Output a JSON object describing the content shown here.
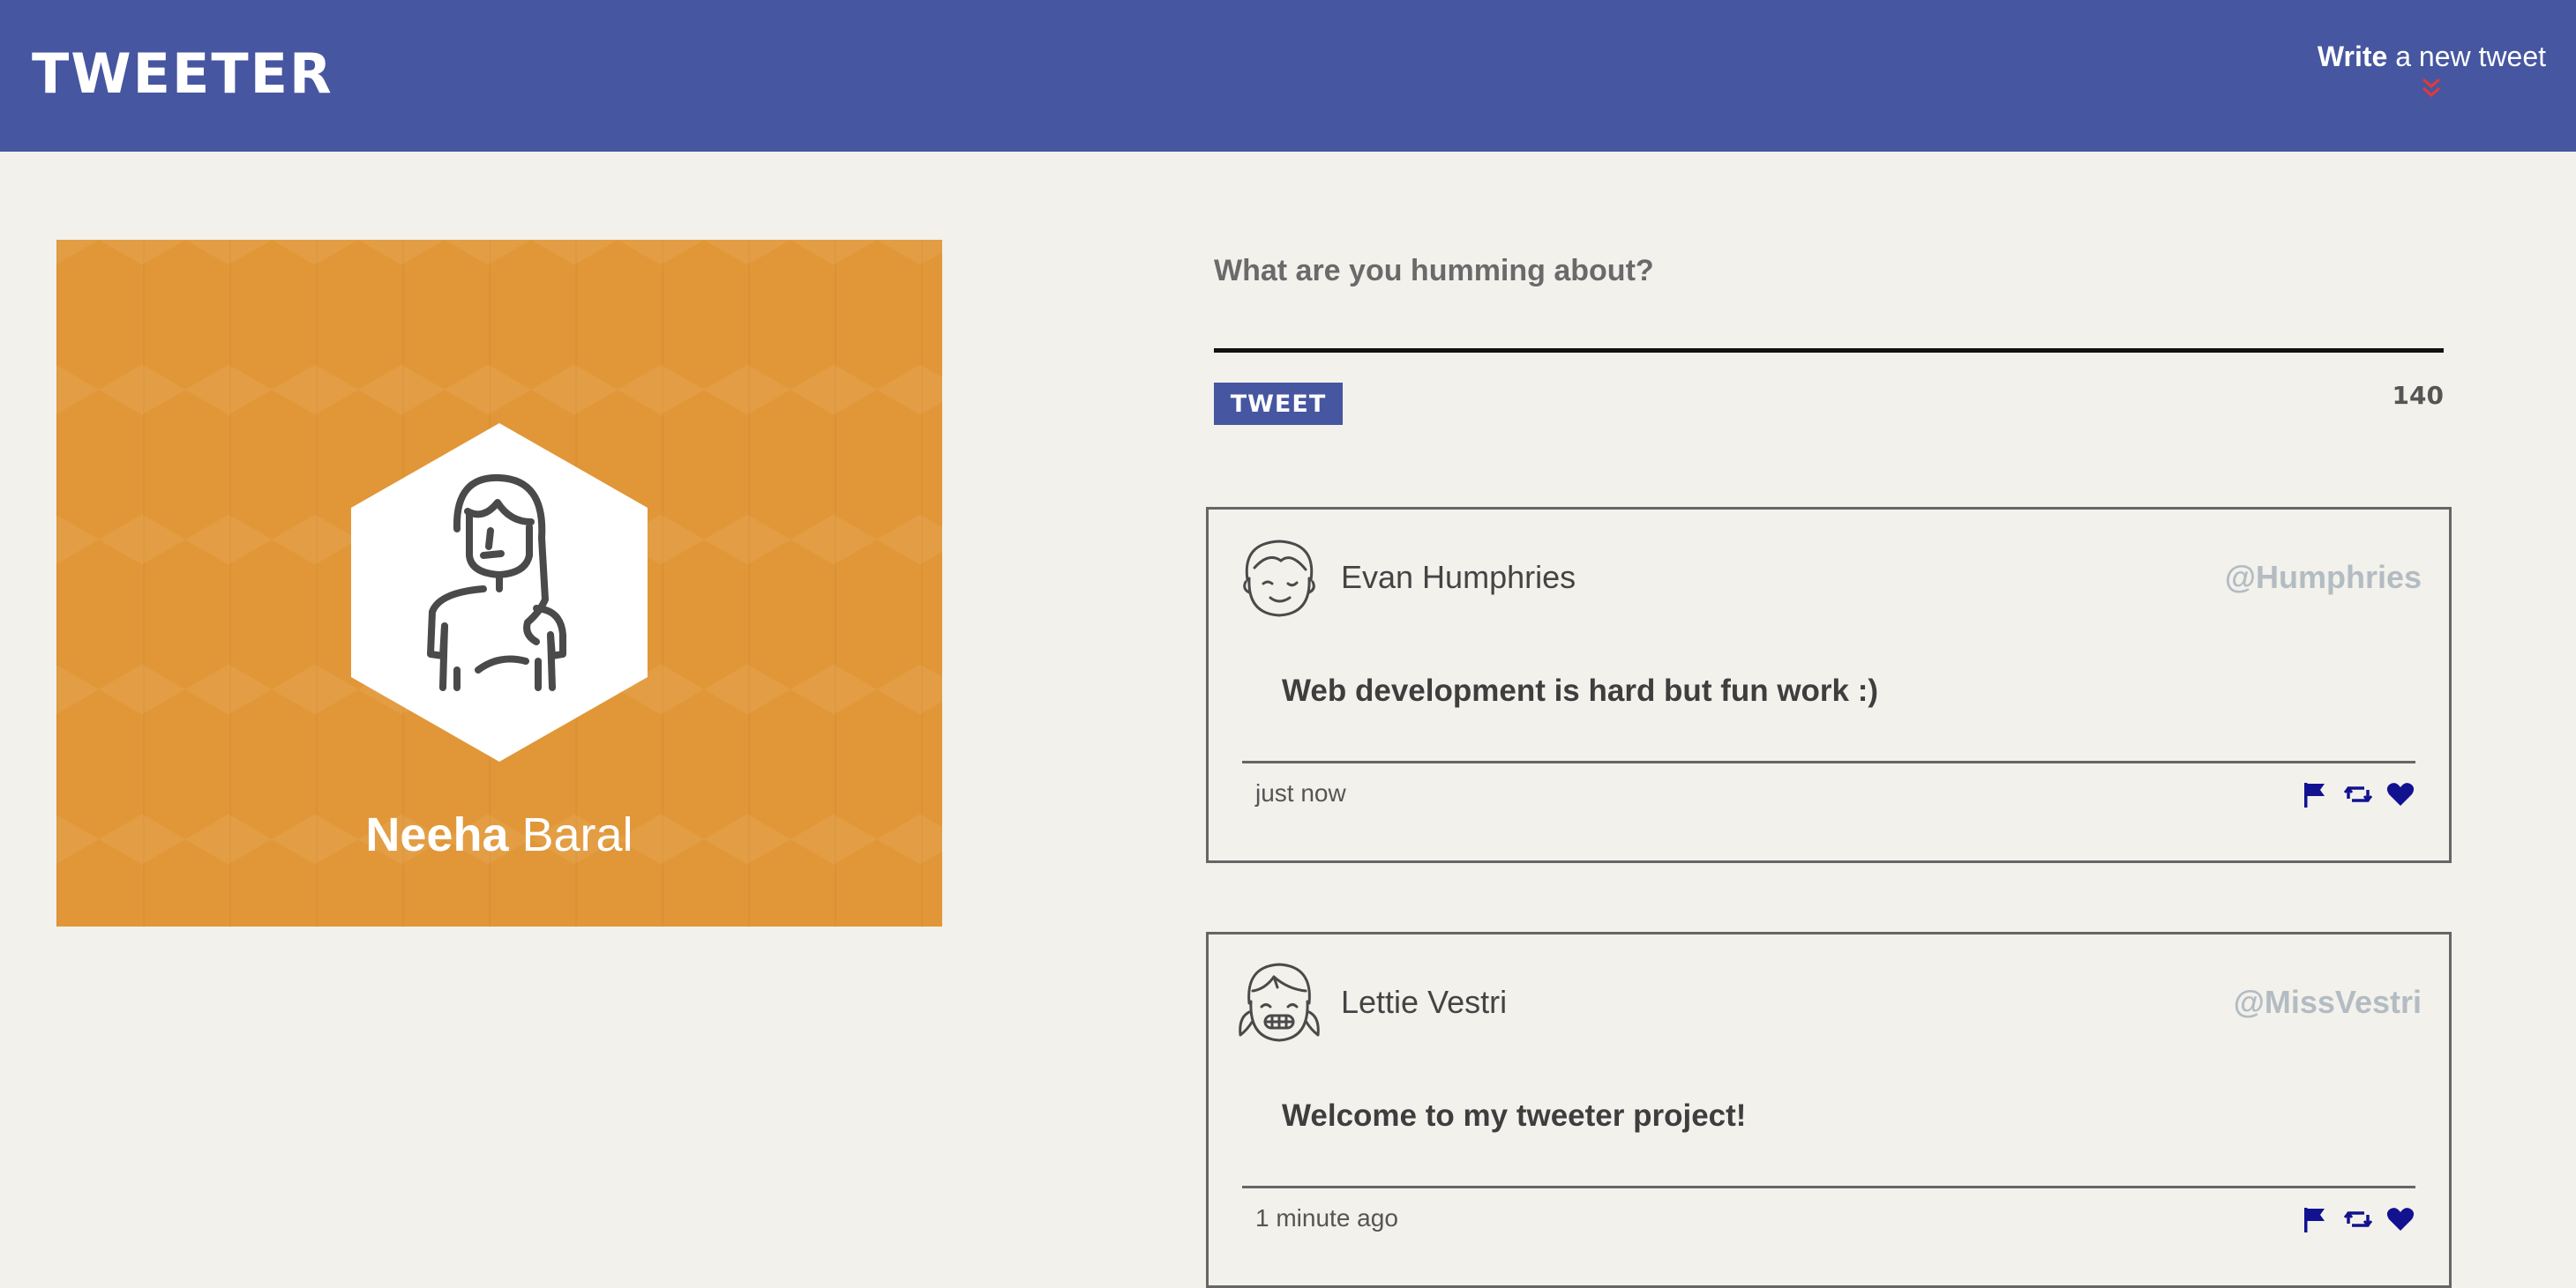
{
  "nav": {
    "brand": "TWEETER",
    "compose_toggle": {
      "bold": "Write",
      "rest": " a new tweet",
      "icon": "double-chevron-down-icon"
    }
  },
  "profile": {
    "first_name": "Neeha",
    "last_name": " Baral",
    "avatar_icon": "girl-avatar-icon",
    "background_color": "#e19737"
  },
  "new_tweet": {
    "placeholder": "What are you humming about?",
    "value": "",
    "submit_label": "TWEET",
    "counter": "140"
  },
  "tweets": [
    {
      "name": "Evan Humphries",
      "handle": "@Humphries",
      "text": "Web development is hard but fun work :)",
      "time": "just now",
      "avatar_icon": "boy-avatar-icon"
    },
    {
      "name": "Lettie Vestri",
      "handle": "@MissVestri",
      "text": "Welcome to my tweeter project!",
      "time": "1 minute ago",
      "avatar_icon": "pigtails-girl-avatar-icon"
    }
  ],
  "tweet_actions": [
    "flag-icon",
    "retweet-icon",
    "heart-icon"
  ],
  "colors": {
    "nav": "#4656a0",
    "page_background": "#f2f1ec",
    "action_icons": "#121290",
    "chevron": "#e53935",
    "handle": "#b3bcc2"
  }
}
